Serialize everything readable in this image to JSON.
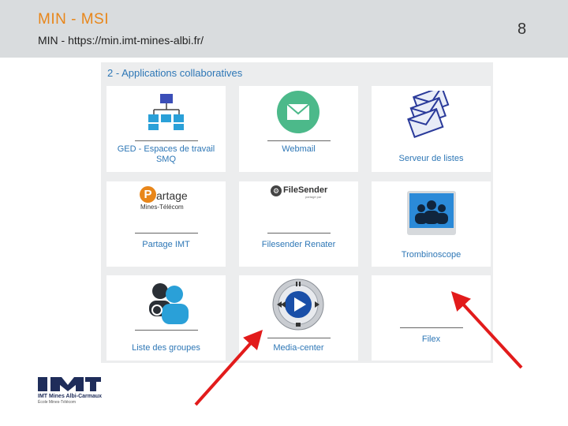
{
  "slide": {
    "title": "MIN - MSI",
    "subtitle": "MIN - https://min.imt-mines-albi.fr/",
    "page_number": "8"
  },
  "panel": {
    "heading": "2 - Applications collaboratives",
    "tiles": [
      {
        "label": "GED - Espaces de travail SMQ",
        "icon": "org-chart-icon"
      },
      {
        "label": "Webmail",
        "icon": "mail-icon"
      },
      {
        "label": "Serveur de listes",
        "icon": "envelopes-icon"
      },
      {
        "label": "Partage IMT",
        "icon": "partage-logo-icon"
      },
      {
        "label": "Filesender Renater",
        "icon": "filesender-logo-icon"
      },
      {
        "label": "Trombinoscope",
        "icon": "people-photo-icon"
      },
      {
        "label": "Liste des groupes",
        "icon": "group-users-icon"
      },
      {
        "label": "Media-center",
        "icon": "media-player-icon"
      },
      {
        "label": "Filex",
        "icon": "blank-icon"
      }
    ],
    "partage_logo": {
      "line1": "artage",
      "line2": "Mines-Télécom",
      "letter": "P"
    },
    "filesender_logo": {
      "text": "FileSender",
      "sub": "partagé par"
    }
  },
  "logo": {
    "name": "IMT Mines Albi-Carmaux",
    "tagline": "École Mines-Télécom"
  },
  "colors": {
    "title": "#e8861a",
    "link": "#2e77b6",
    "header_bg": "#d9dcde",
    "arrow": "#e21b1b"
  }
}
